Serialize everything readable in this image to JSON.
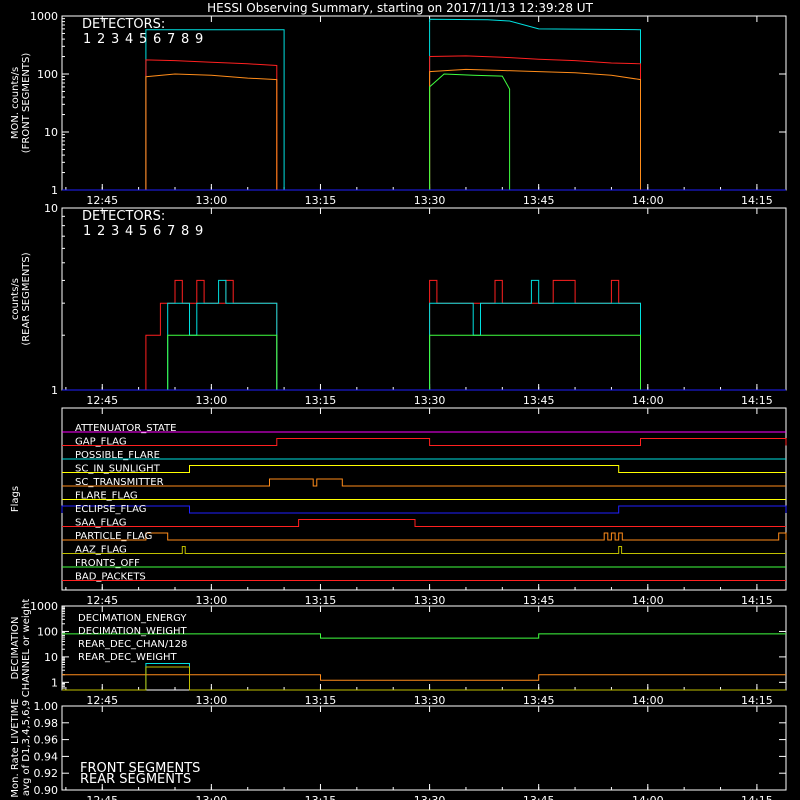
{
  "title": "HESSI Observing Summary, starting on 2017/11/13 12:39:28 UT",
  "time_ticks": [
    "12:45",
    "13:00",
    "13:15",
    "13:30",
    "13:45",
    "14:00",
    "14:15"
  ],
  "colors": {
    "d1": "#ff2020",
    "d2": "#ff3030",
    "d3": "#ff8c1a",
    "d4": "#ffff00",
    "d5": "#00cc00",
    "d6": "#40ff40",
    "d7": "#00e0e0",
    "d8": "#30c0ff",
    "d9": "#2020ff"
  },
  "chart_data": [
    {
      "type": "line",
      "id": "front",
      "ylabel": "MON. counts/s (FRONT SEGMENTS)",
      "ylabel_lines": [
        "MON. counts/s",
        "(FRONT SEGMENTS)"
      ],
      "yscale": "log",
      "ylim": [
        1,
        1000
      ],
      "ytick_labels": [
        "1",
        "10",
        "100",
        "1000"
      ],
      "xlim": [
        "12:39:28",
        "14:19"
      ],
      "legend_title": "DETECTORS:",
      "legend_numbers": [
        "1",
        "2",
        "3",
        "4",
        "5",
        "6",
        "7",
        "8",
        "9"
      ],
      "series": [
        {
          "color": "#00e0e0",
          "points": [
            [
              "12:39:28",
              1
            ],
            [
              "12:51",
              1
            ],
            [
              "12:51",
              580
            ],
            [
              "13:10",
              580
            ],
            [
              "13:10",
              1
            ],
            [
              "13:30",
              1
            ],
            [
              "13:30",
              880
            ],
            [
              "13:38",
              860
            ],
            [
              "13:41",
              820
            ],
            [
              "13:45",
              600
            ],
            [
              "13:59",
              580
            ],
            [
              "13:59",
              1
            ],
            [
              "14:19",
              1
            ]
          ]
        },
        {
          "color": "#ff2020",
          "points": [
            [
              "12:39:28",
              1
            ],
            [
              "12:51",
              1
            ],
            [
              "12:51",
              3
            ],
            [
              "12:51",
              175
            ],
            [
              "12:55",
              170
            ],
            [
              "13:00",
              160
            ],
            [
              "13:05",
              150
            ],
            [
              "13:09",
              140
            ],
            [
              "13:09",
              1
            ],
            [
              "13:30",
              1
            ],
            [
              "13:30",
              200
            ],
            [
              "13:35",
              205
            ],
            [
              "13:40",
              195
            ],
            [
              "13:45",
              180
            ],
            [
              "13:50",
              170
            ],
            [
              "13:55",
              155
            ],
            [
              "13:59",
              150
            ],
            [
              "13:59",
              1
            ],
            [
              "14:19",
              1
            ]
          ]
        },
        {
          "color": "#ff8c1a",
          "points": [
            [
              "12:39:28",
              1
            ],
            [
              "12:51",
              1
            ],
            [
              "12:51",
              90
            ],
            [
              "12:55",
              100
            ],
            [
              "13:00",
              95
            ],
            [
              "13:05",
              85
            ],
            [
              "13:09",
              80
            ],
            [
              "13:09",
              1
            ],
            [
              "13:30",
              1
            ],
            [
              "13:30",
              110
            ],
            [
              "13:35",
              120
            ],
            [
              "13:40",
              115
            ],
            [
              "13:45",
              110
            ],
            [
              "13:50",
              105
            ],
            [
              "13:55",
              95
            ],
            [
              "13:59",
              80
            ],
            [
              "13:59",
              1
            ],
            [
              "14:19",
              1
            ]
          ]
        },
        {
          "color": "#40ff40",
          "points": [
            [
              "12:39:28",
              1
            ],
            [
              "13:30",
              1
            ],
            [
              "13:30",
              60
            ],
            [
              "13:32",
              100
            ],
            [
              "13:36",
              95
            ],
            [
              "13:40",
              92
            ],
            [
              "13:41",
              55
            ],
            [
              "13:41",
              1
            ],
            [
              "14:19",
              1
            ]
          ]
        },
        {
          "color": "#2020ff",
          "points": [
            [
              "12:39:28",
              1
            ],
            [
              "14:19",
              1
            ]
          ]
        }
      ]
    },
    {
      "type": "line",
      "id": "rear",
      "ylabel": "counts/s (REAR SEGMENTS)",
      "ylabel_lines": [
        "counts/s",
        "(REAR SEGMENTS)"
      ],
      "yscale": "log",
      "ylim": [
        1,
        10
      ],
      "ytick_labels": [
        "1",
        "10"
      ],
      "xlim": [
        "12:39:28",
        "14:19"
      ],
      "legend_title": "DETECTORS:",
      "legend_numbers": [
        "1",
        "2",
        "3",
        "4",
        "5",
        "6",
        "7",
        "8",
        "9"
      ],
      "series": [
        {
          "color": "#ff2020",
          "points": [
            [
              "12:39:28",
              1
            ],
            [
              "12:51",
              1
            ],
            [
              "12:51",
              2
            ],
            [
              "12:53",
              2
            ],
            [
              "12:53",
              3
            ],
            [
              "12:55",
              3
            ],
            [
              "12:55",
              4
            ],
            [
              "12:56",
              4
            ],
            [
              "12:56",
              3
            ],
            [
              "12:58",
              3
            ],
            [
              "12:58",
              4
            ],
            [
              "12:59",
              4
            ],
            [
              "12:59",
              3
            ],
            [
              "13:02",
              3
            ],
            [
              "13:02",
              4
            ],
            [
              "13:03",
              4
            ],
            [
              "13:03",
              3
            ],
            [
              "13:09",
              3
            ],
            [
              "13:09",
              1
            ],
            [
              "13:30",
              1
            ],
            [
              "13:30",
              4
            ],
            [
              "13:31",
              4
            ],
            [
              "13:31",
              3
            ],
            [
              "13:39",
              3
            ],
            [
              "13:39",
              4
            ],
            [
              "13:40",
              4
            ],
            [
              "13:40",
              3
            ],
            [
              "13:47",
              3
            ],
            [
              "13:47",
              4
            ],
            [
              "13:50",
              4
            ],
            [
              "13:50",
              3
            ],
            [
              "13:55",
              3
            ],
            [
              "13:55",
              4
            ],
            [
              "13:56",
              4
            ],
            [
              "13:56",
              3
            ],
            [
              "13:59",
              3
            ],
            [
              "13:59",
              1
            ],
            [
              "14:19",
              1
            ]
          ]
        },
        {
          "color": "#00e0e0",
          "points": [
            [
              "12:39:28",
              1
            ],
            [
              "12:54",
              1
            ],
            [
              "12:54",
              3
            ],
            [
              "12:57",
              3
            ],
            [
              "12:57",
              2
            ],
            [
              "12:58",
              2
            ],
            [
              "12:58",
              3
            ],
            [
              "13:01",
              3
            ],
            [
              "13:01",
              4
            ],
            [
              "13:02",
              4
            ],
            [
              "13:02",
              3
            ],
            [
              "13:09",
              3
            ],
            [
              "13:09",
              1
            ],
            [
              "13:30",
              1
            ],
            [
              "13:30",
              3
            ],
            [
              "13:36",
              3
            ],
            [
              "13:36",
              2
            ],
            [
              "13:37",
              2
            ],
            [
              "13:37",
              3
            ],
            [
              "13:44",
              3
            ],
            [
              "13:44",
              4
            ],
            [
              "13:45",
              4
            ],
            [
              "13:45",
              3
            ],
            [
              "13:59",
              3
            ],
            [
              "13:59",
              1
            ],
            [
              "14:19",
              1
            ]
          ]
        },
        {
          "color": "#40ff40",
          "points": [
            [
              "12:39:28",
              1
            ],
            [
              "12:54",
              1
            ],
            [
              "12:54",
              2
            ],
            [
              "13:09",
              2
            ],
            [
              "13:09",
              1
            ],
            [
              "13:30",
              1
            ],
            [
              "13:30",
              2
            ],
            [
              "13:59",
              2
            ],
            [
              "13:59",
              1
            ],
            [
              "14:19",
              1
            ]
          ]
        },
        {
          "color": "#2020ff",
          "points": [
            [
              "12:39:28",
              1
            ],
            [
              "14:19",
              1
            ]
          ]
        }
      ]
    },
    {
      "type": "line",
      "id": "flags",
      "ylabel": "Flags",
      "xlim": [
        "12:39:28",
        "14:19"
      ],
      "flags": [
        {
          "name": "ATTENUATOR_STATE",
          "color": "#ff00ff",
          "on": []
        },
        {
          "name": "GAP_FLAG",
          "color": "#ff2020",
          "on": [
            [
              "13:09",
              "13:30"
            ],
            [
              "13:59",
              "14:19"
            ]
          ]
        },
        {
          "name": "POSSIBLE_FLARE",
          "color": "#00e0e0",
          "on": []
        },
        {
          "name": "SC_IN_SUNLIGHT",
          "color": "#ffff00",
          "on": [
            [
              "12:57",
              "13:56"
            ]
          ]
        },
        {
          "name": "SC_TRANSMITTER",
          "color": "#ff8c1a",
          "on": [
            [
              "13:08",
              "13:14"
            ],
            [
              "13:14.5",
              "13:18"
            ]
          ]
        },
        {
          "name": "FLARE_FLAG",
          "color": "#ffff00",
          "on": []
        },
        {
          "name": "ECLIPSE_FLAG",
          "color": "#2020ff",
          "on": [
            [
              "12:39:28",
              "12:57"
            ],
            [
              "13:56",
              "14:19"
            ]
          ]
        },
        {
          "name": "SAA_FLAG",
          "color": "#ff2020",
          "on": [
            [
              "13:12",
              "13:28"
            ]
          ]
        },
        {
          "name": "PARTICLE_FLAG",
          "color": "#ff8c1a",
          "on": [
            [
              "12:51",
              "12:54"
            ],
            [
              "13:54",
              "13:54.5"
            ],
            [
              "13:55",
              "13:55.5"
            ],
            [
              "13:56",
              "13:56.5"
            ],
            [
              "14:18",
              "14:19"
            ]
          ]
        },
        {
          "name": "AAZ_FLAG",
          "color": "#c0c000",
          "on": [
            [
              "12:56",
              "12:56.4"
            ],
            [
              "13:56",
              "13:56.4"
            ]
          ]
        },
        {
          "name": "FRONTS_OFF",
          "color": "#40ff40",
          "on": []
        },
        {
          "name": "BAD_PACKETS",
          "color": "#ff2020",
          "on": []
        }
      ]
    },
    {
      "type": "line",
      "id": "decimation",
      "ylabel": "DECIMATION CHANNEL or weight",
      "ylabel_lines": [
        "DECIMATION",
        "CHANNEL or weight"
      ],
      "yscale": "log",
      "ylim": [
        0.5,
        1000
      ],
      "ytick_labels": [
        "1",
        "10",
        "100",
        "1000"
      ],
      "xlim": [
        "12:39:28",
        "14:19"
      ],
      "legend": [
        "DECIMATION_ENERGY",
        "DECIMATION_WEIGHT",
        "REAR_DEC_CHAN/128",
        "REAR_DEC_WEIGHT"
      ],
      "series": [
        {
          "name": "DECIMATION_ENERGY",
          "color": "#40ff40",
          "points": [
            [
              "12:39:28",
              80
            ],
            [
              "13:15",
              80
            ],
            [
              "13:15",
              55
            ],
            [
              "13:45",
              55
            ],
            [
              "13:45",
              80
            ],
            [
              "14:19",
              80
            ]
          ]
        },
        {
          "name": "DECIMATION_WEIGHT",
          "color": "#ff8c1a",
          "points": [
            [
              "12:39:28",
              2
            ],
            [
              "13:15",
              2
            ],
            [
              "13:15",
              1.2
            ],
            [
              "13:45",
              1.2
            ],
            [
              "13:45",
              2
            ],
            [
              "14:19",
              2
            ]
          ]
        },
        {
          "name": "REAR_DEC_CHAN/128",
          "color": "#00e0e0",
          "points": [
            [
              "12:39:28",
              0.5
            ],
            [
              "12:51",
              0.5
            ],
            [
              "12:51",
              5.5
            ],
            [
              "12:57",
              5.5
            ],
            [
              "12:57",
              0.5
            ],
            [
              "14:19",
              0.5
            ]
          ]
        },
        {
          "name": "REAR_DEC_WEIGHT",
          "color": "#c0c000",
          "points": [
            [
              "12:39:28",
              0.5
            ],
            [
              "12:51",
              0.5
            ],
            [
              "12:51",
              4
            ],
            [
              "12:57",
              4
            ],
            [
              "12:57",
              0.5
            ],
            [
              "14:19",
              0.5
            ]
          ]
        }
      ]
    },
    {
      "type": "line",
      "id": "livetime",
      "ylabel": "Mon. Rate LIVETIME avg of D1,3,4,5,6,9",
      "ylabel_lines": [
        "Mon. Rate LIVETIME",
        "avg of D1,3,4,5,6,9"
      ],
      "ylim": [
        0.9,
        1.0
      ],
      "ytick_labels": [
        "0.90",
        "0.92",
        "0.94",
        "0.96",
        "0.98",
        "1.00"
      ],
      "xlim": [
        "12:39:28",
        "14:19"
      ],
      "legend": [
        "FRONT SEGMENTS",
        "REAR SEGMENTS"
      ],
      "legend_colors": [
        "#40ff40",
        "#00a000"
      ],
      "series": []
    }
  ]
}
